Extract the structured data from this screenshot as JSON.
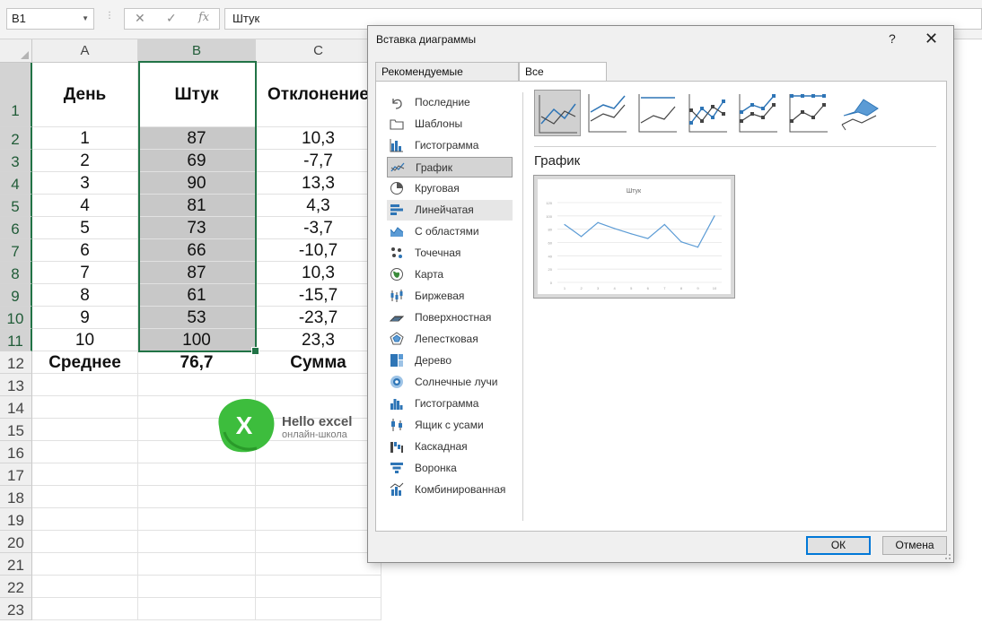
{
  "formula_bar": {
    "name_box": "B1",
    "cancel_icon": "✕",
    "enter_icon": "✓",
    "fx_label": "fx",
    "formula": "Штук"
  },
  "sheet": {
    "columns": [
      "A",
      "B",
      "C"
    ],
    "rows": [
      "1",
      "2",
      "3",
      "4",
      "5",
      "6",
      "7",
      "8",
      "9",
      "10",
      "11",
      "12",
      "13",
      "14",
      "15",
      "16",
      "17",
      "18",
      "19",
      "20",
      "21",
      "22",
      "23"
    ],
    "header_row": [
      "День",
      "Штук",
      "Отклонение"
    ],
    "data": [
      [
        "1",
        "87",
        "10,3"
      ],
      [
        "2",
        "69",
        "-7,7"
      ],
      [
        "3",
        "90",
        "13,3"
      ],
      [
        "4",
        "81",
        "4,3"
      ],
      [
        "5",
        "73",
        "-3,7"
      ],
      [
        "6",
        "66",
        "-10,7"
      ],
      [
        "7",
        "87",
        "10,3"
      ],
      [
        "8",
        "61",
        "-15,7"
      ],
      [
        "9",
        "53",
        "-23,7"
      ],
      [
        "10",
        "100",
        "23,3"
      ]
    ],
    "footer_row": [
      "Среднее",
      "76,7",
      "Сумма"
    ],
    "selected_column": "B",
    "accent_color": "#217346"
  },
  "logo": {
    "mark": "X",
    "title": "Hello excel",
    "subtitle": "онлайн-школа",
    "color": "#3dbd3d"
  },
  "dialog": {
    "title": "Вставка диаграммы",
    "help": "?",
    "close": "✕",
    "tabs": [
      "Рекомендуемые диаграммы",
      "Все диаграммы"
    ],
    "active_tab": 1,
    "chart_types": [
      {
        "label": "Последние",
        "icon": "undo-icon"
      },
      {
        "label": "Шаблоны",
        "icon": "folder-icon"
      },
      {
        "label": "Гистограмма",
        "icon": "column-chart-icon"
      },
      {
        "label": "График",
        "icon": "line-chart-icon"
      },
      {
        "label": "Круговая",
        "icon": "pie-chart-icon"
      },
      {
        "label": "Линейчатая",
        "icon": "bar-chart-icon"
      },
      {
        "label": "С областями",
        "icon": "area-chart-icon"
      },
      {
        "label": "Точечная",
        "icon": "scatter-chart-icon"
      },
      {
        "label": "Карта",
        "icon": "map-chart-icon"
      },
      {
        "label": "Биржевая",
        "icon": "stock-chart-icon"
      },
      {
        "label": "Поверхностная",
        "icon": "surface-chart-icon"
      },
      {
        "label": "Лепестковая",
        "icon": "radar-chart-icon"
      },
      {
        "label": "Дерево",
        "icon": "treemap-chart-icon"
      },
      {
        "label": "Солнечные лучи",
        "icon": "sunburst-chart-icon"
      },
      {
        "label": "Гистограмма",
        "icon": "histogram-chart-icon"
      },
      {
        "label": "Ящик с усами",
        "icon": "box-whisker-chart-icon"
      },
      {
        "label": "Каскадная",
        "icon": "waterfall-chart-icon"
      },
      {
        "label": "Воронка",
        "icon": "funnel-chart-icon"
      },
      {
        "label": "Комбинированная",
        "icon": "combo-chart-icon"
      }
    ],
    "selected_type": 3,
    "hover_type": 5,
    "subtypes": [
      "line",
      "stacked-line",
      "100-stacked-line",
      "line-markers",
      "stacked-line-markers",
      "100-stacked-line-markers",
      "3d-line"
    ],
    "selected_subtype": 0,
    "subtype_heading": "График",
    "preview": {
      "title": "Штук",
      "y_ticks": [
        "120",
        "100",
        "80",
        "60",
        "40",
        "20",
        "0"
      ],
      "x_ticks": [
        "1",
        "2",
        "3",
        "4",
        "5",
        "6",
        "7",
        "8",
        "9",
        "10"
      ]
    },
    "ok": "ОК",
    "cancel": "Отмена"
  },
  "chart_data": {
    "type": "line",
    "title": "Штук",
    "x": [
      1,
      2,
      3,
      4,
      5,
      6,
      7,
      8,
      9,
      10
    ],
    "values": [
      87,
      69,
      90,
      81,
      73,
      66,
      87,
      61,
      53,
      100
    ],
    "ylim": [
      0,
      120
    ],
    "color": "#5b9bd5"
  }
}
